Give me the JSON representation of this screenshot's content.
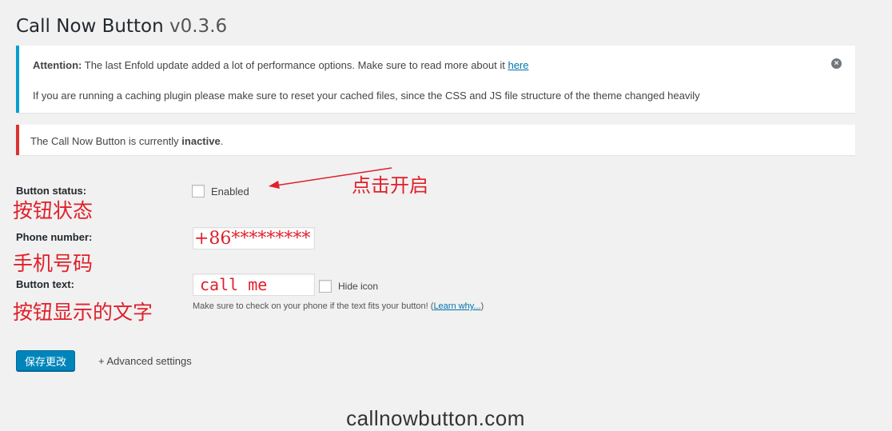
{
  "page": {
    "title": "Call Now Button",
    "version": "v0.3.6"
  },
  "notices": {
    "info": {
      "line1_strong": "Attention:",
      "line1_text": " The last Enfold update added a lot of performance options. Make sure to read more about it ",
      "line1_link": "here",
      "line2": "If you are running a caching plugin please make sure to reset your cached files, since the CSS and JS file structure of the theme changed heavily",
      "dismiss_symbol": "×",
      "border_color": "#00a0d2"
    },
    "error": {
      "text": "The Call Now Button is currently ",
      "strong": "inactive",
      "suffix": ".",
      "border_color": "#dc3232"
    }
  },
  "form": {
    "button_status": {
      "label": "Button status:",
      "checkbox_label": "Enabled",
      "checked": false,
      "annotation": "按钮状态"
    },
    "phone_number": {
      "label": "Phone number:",
      "value": "+86*********",
      "annotation": "手机号码"
    },
    "button_text": {
      "label": "Button text:",
      "value": "call me",
      "hide_icon_label": "Hide icon",
      "hide_icon_checked": false,
      "annotation": "按钮显示的文字",
      "description": "Make sure to check on your phone if the text fits your button! (",
      "description_link": "Learn why...",
      "description_suffix": ")"
    }
  },
  "actions": {
    "save_label": "保存更改",
    "advanced_label": "+ Advanced settings"
  },
  "annotations": {
    "enable_note": "点击开启"
  },
  "watermark": "callnowbutton.com"
}
